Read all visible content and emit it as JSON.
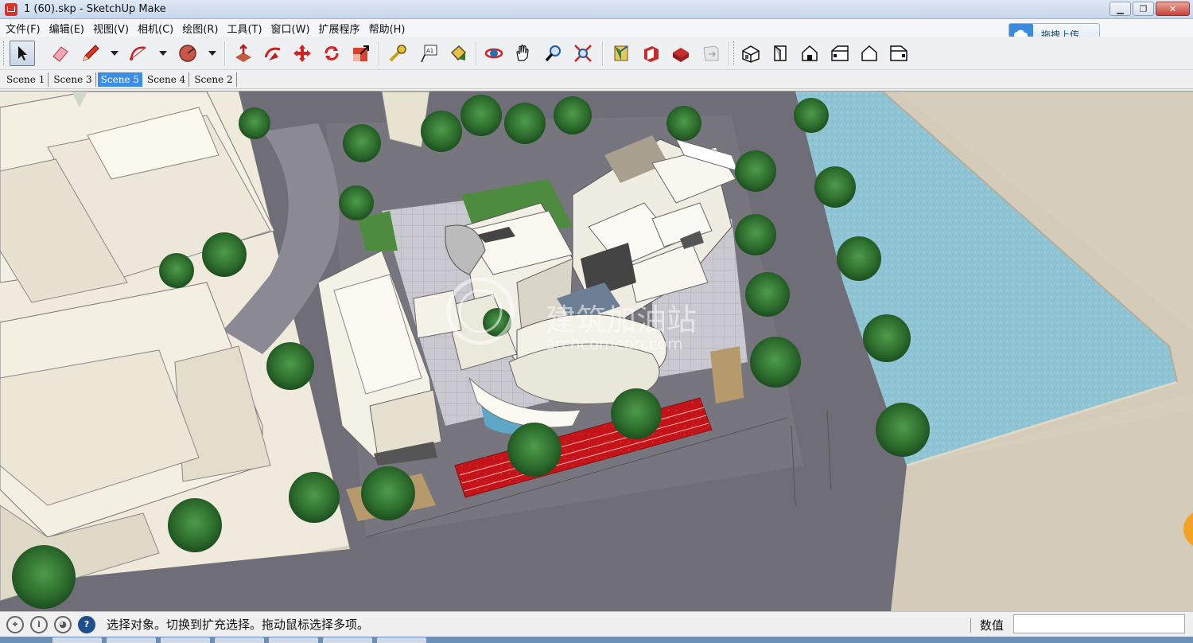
{
  "window": {
    "title": "1 (60).skp - SketchUp Make",
    "minimize_label": "▁",
    "restore_label": "❐",
    "close_label": "✕"
  },
  "menu": {
    "items": [
      "文件(F)",
      "编辑(E)",
      "视图(V)",
      "相机(C)",
      "绘图(R)",
      "工具(T)",
      "窗口(W)",
      "扩展程序",
      "帮助(H)"
    ]
  },
  "upload": {
    "label": "拖拽上传"
  },
  "scenes": {
    "tabs": [
      "Scene 1",
      "Scene 3",
      "Scene 5",
      "Scene 4",
      "Scene 2"
    ],
    "active": "Scene 5"
  },
  "toolbar": {
    "tools": [
      "select-icon",
      "eraser-icon",
      "pencil-icon",
      "arc-icon",
      "shape-icon",
      "push-pull-icon",
      "follow-me-icon",
      "move-icon",
      "rotate-icon",
      "scale-icon",
      "tape-measure-icon",
      "text-icon",
      "paint-bucket-icon",
      "orbit-icon",
      "pan-icon",
      "zoom-icon",
      "zoom-extents-icon",
      "warehouse-icon",
      "sketchup-share-icon",
      "extension-warehouse-icon",
      "send-to-layout-icon",
      "iso-view-icon",
      "top-view-icon",
      "front-view-icon",
      "right-view-icon",
      "back-view-icon",
      "left-view-icon"
    ]
  },
  "viewport": {
    "watermark_title": "建筑加油站",
    "watermark_url": "archcomeon.com"
  },
  "status": {
    "text": "选择对象。切换到扩充选择。拖动鼠标选择多项。",
    "measurements_label": "数值",
    "info_icon_label": "i",
    "help_icon_label": "?"
  },
  "colors": {
    "water": "#8fc4d4",
    "road": "#6e6e7a",
    "ground": "#d7cfbd",
    "track": "#c4141a",
    "scene_active": "#3a8ee6"
  }
}
